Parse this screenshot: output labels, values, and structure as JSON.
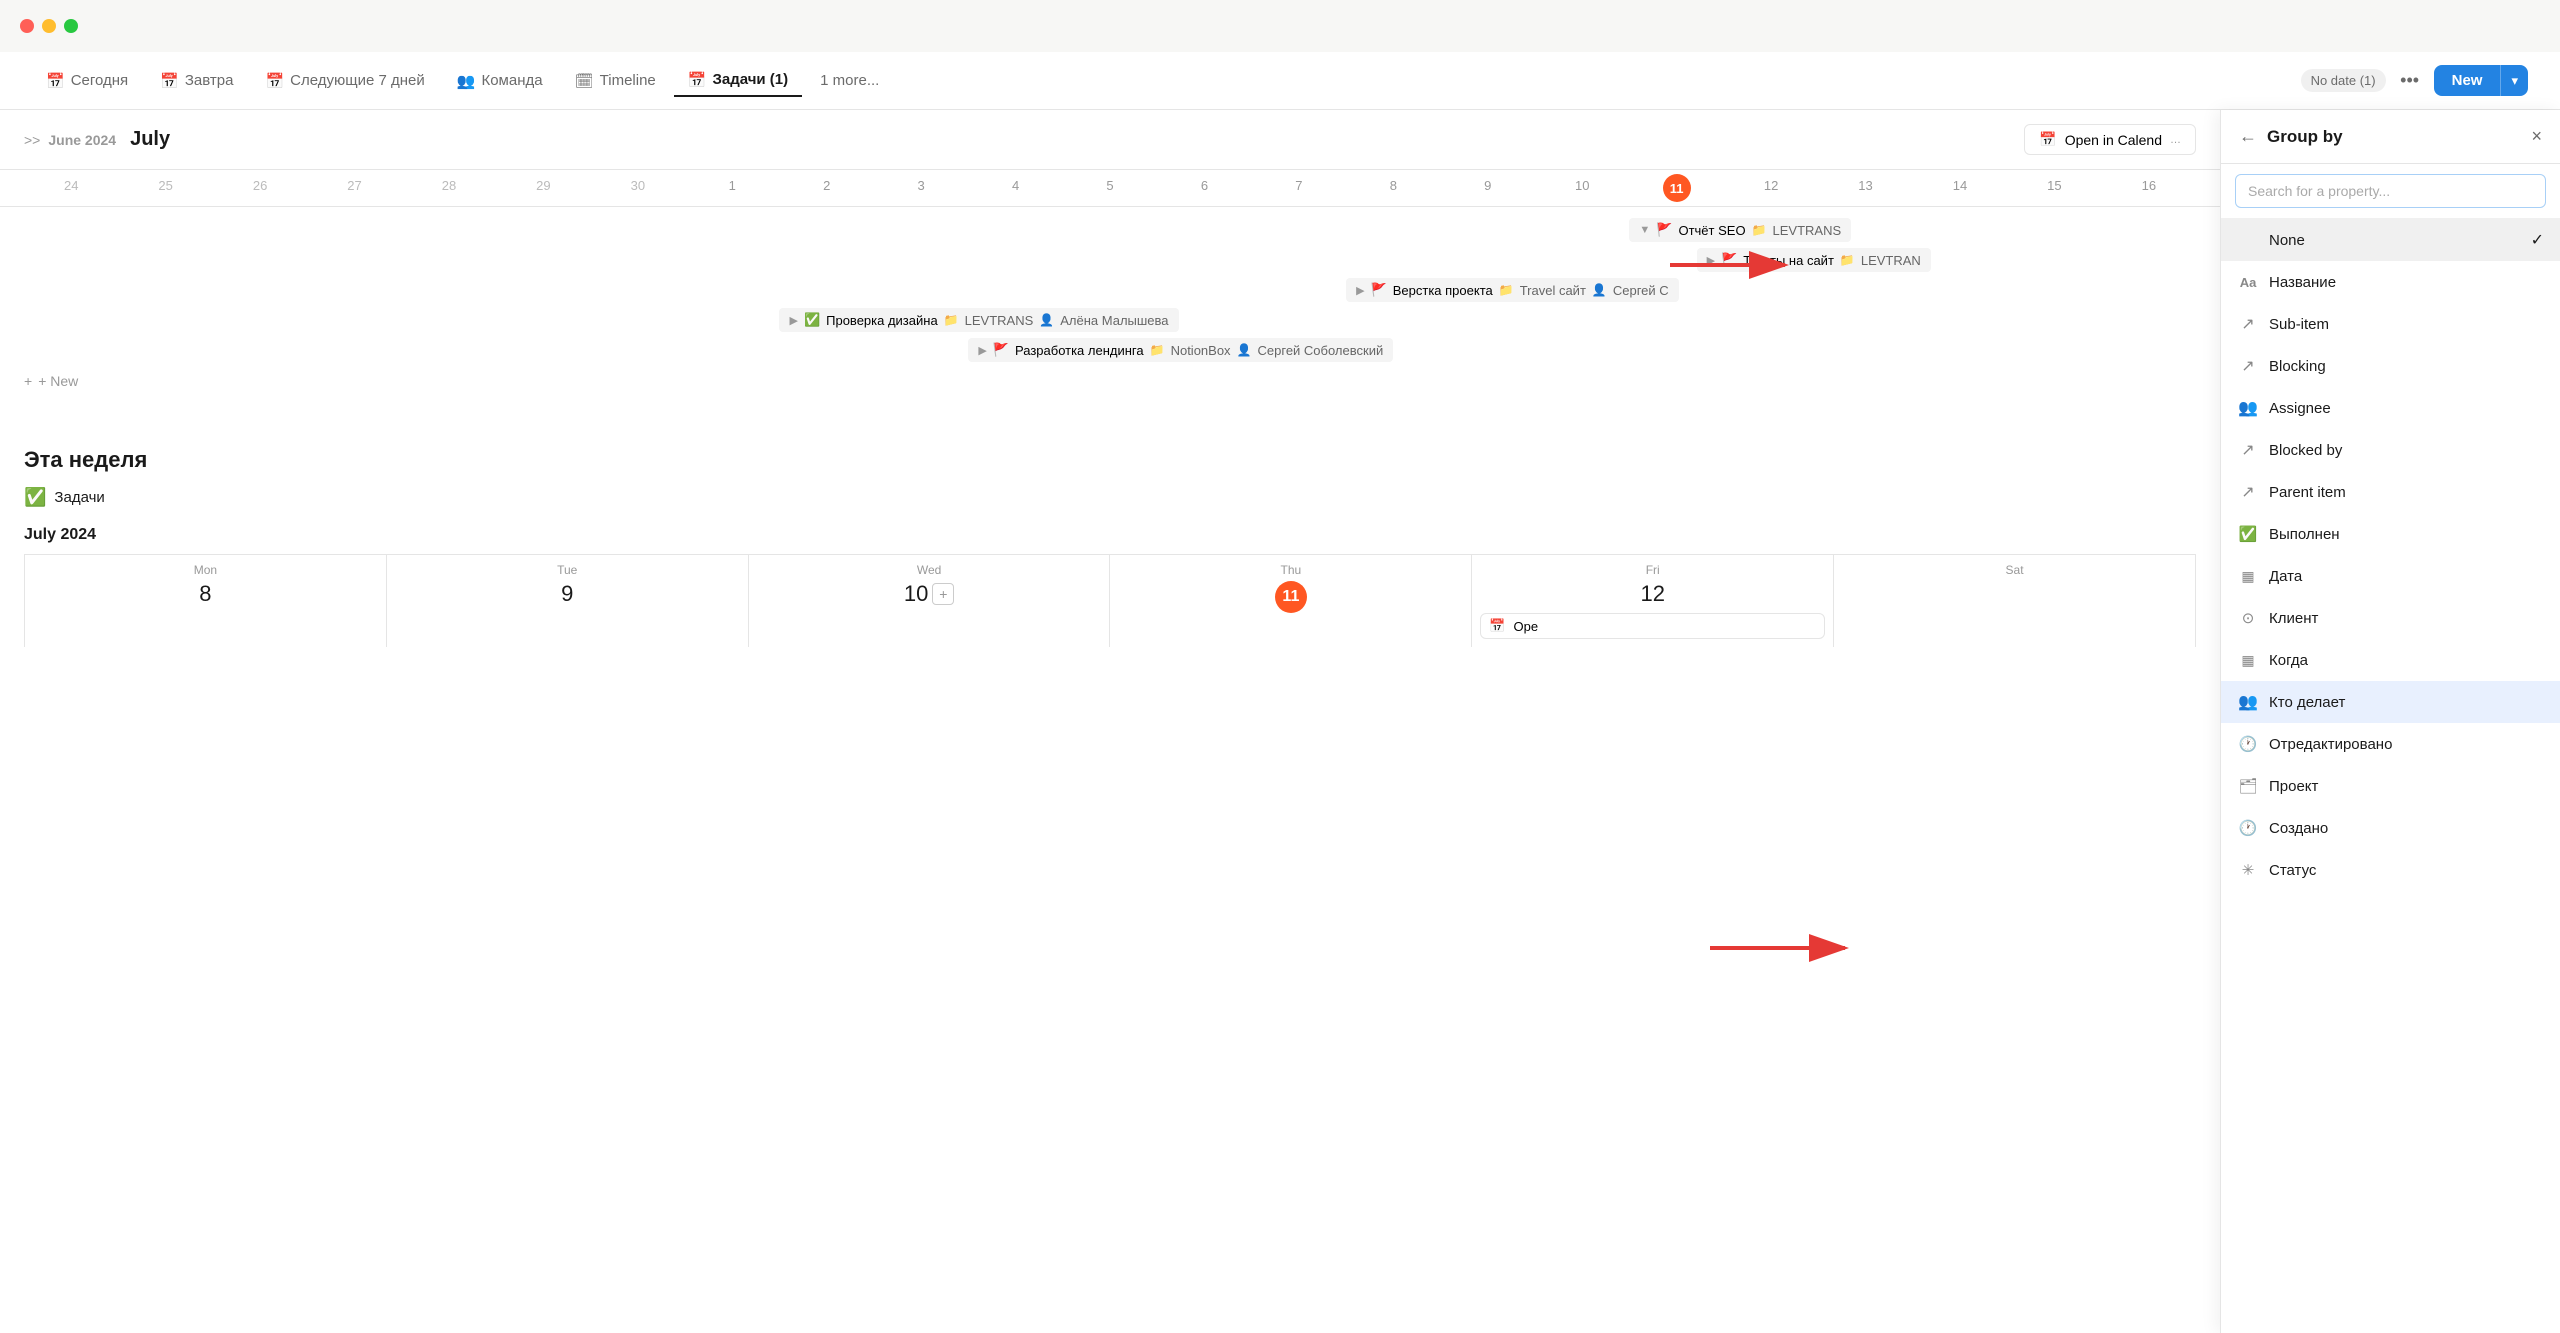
{
  "titlebar": {
    "traffic_lights": [
      "red",
      "yellow",
      "green"
    ]
  },
  "nav": {
    "tabs": [
      {
        "id": "today",
        "label": "Сегодня",
        "icon": "📅"
      },
      {
        "id": "tomorrow",
        "label": "Завтра",
        "icon": "📅"
      },
      {
        "id": "next7",
        "label": "Следующие 7 дней",
        "icon": "📅"
      },
      {
        "id": "team",
        "label": "Команда",
        "icon": "👥"
      },
      {
        "id": "timeline",
        "label": "Timeline",
        "icon": "🗓"
      },
      {
        "id": "zadachi",
        "label": "Задачи (1)",
        "icon": "📅",
        "active": true
      },
      {
        "id": "more",
        "label": "1 more...",
        "icon": ""
      }
    ],
    "no_date": "No date (1)",
    "dots": "•••",
    "new_btn": "New",
    "new_arrow": "▾"
  },
  "calendar": {
    "prev_month": "June 2024",
    "current_month": "July",
    "prev_chevron": ">>",
    "open_in_calendar": "Open in Calend",
    "dates": [
      "24",
      "25",
      "26",
      "27",
      "28",
      "29",
      "30",
      "1",
      "2",
      "3",
      "4",
      "5",
      "6",
      "7",
      "8",
      "9",
      "10",
      "11",
      "12",
      "13",
      "14",
      "15",
      "16"
    ],
    "today_date": "11",
    "tasks": [
      {
        "indent": 0,
        "collapsed": true,
        "flag": true,
        "name": "Отчёт SEO",
        "folder": "LEVTRANS",
        "user": ""
      },
      {
        "indent": 1,
        "collapsed": true,
        "flag": true,
        "name": "Тексты на сайт",
        "folder": "LEVTRAN",
        "user": ""
      },
      {
        "indent": 0,
        "collapsed": true,
        "flag": true,
        "name": "Верстка проекта",
        "folder": "Travel сайт",
        "user": "Сергей С"
      },
      {
        "indent": 0,
        "collapsed": false,
        "flag": false,
        "done": true,
        "name": "Проверка дизайна",
        "folder": "LEVTRANS",
        "user": "Алёна Малышева"
      },
      {
        "indent": 0,
        "collapsed": true,
        "flag": true,
        "name": "Разработка лендинга",
        "folder": "NotionBox",
        "user": "Сергей Соболевский"
      }
    ],
    "add_new": "+ New",
    "this_week_title": "Эта неделя",
    "task_check_label": "Задачи",
    "month_2024_label": "July 2024",
    "week_days": [
      "Mon",
      "Tue",
      "Wed",
      "Thu",
      "Fri",
      "Sat"
    ],
    "week_dates": [
      "8",
      "9",
      "10",
      "11",
      "12",
      ""
    ],
    "today_week_date": "11",
    "open_in_cal_2": "Ope"
  },
  "groupby_panel": {
    "back_icon": "←",
    "title": "Group by",
    "close_icon": "×",
    "search_placeholder": "Search for a property...",
    "items": [
      {
        "id": "none",
        "icon": "",
        "label": "None",
        "check": "✓",
        "type": "none"
      },
      {
        "id": "name",
        "icon": "Aa",
        "label": "Название",
        "check": "",
        "type": "text"
      },
      {
        "id": "subitem",
        "icon": "↗",
        "label": "Sub-item",
        "check": "",
        "type": "link"
      },
      {
        "id": "blocking",
        "icon": "↗",
        "label": "Blocking",
        "check": "",
        "type": "link"
      },
      {
        "id": "assignee",
        "icon": "👥",
        "label": "Assignee",
        "check": "",
        "type": "people"
      },
      {
        "id": "blocked",
        "icon": "↗",
        "label": "Blocked by",
        "check": "",
        "type": "link"
      },
      {
        "id": "parent",
        "icon": "↗",
        "label": "Parent item",
        "check": "",
        "type": "link"
      },
      {
        "id": "vypolnen",
        "icon": "✅",
        "label": "Выполнен",
        "check": "",
        "type": "check"
      },
      {
        "id": "data",
        "icon": "▦",
        "label": "Дата",
        "check": "",
        "type": "calendar"
      },
      {
        "id": "klient",
        "icon": "🔘",
        "label": "Клиент",
        "check": "",
        "type": "option"
      },
      {
        "id": "kogda",
        "icon": "▦",
        "label": "Когда",
        "check": "",
        "type": "calendar"
      },
      {
        "id": "kto",
        "icon": "👥",
        "label": "Кто делает",
        "check": "",
        "type": "people",
        "highlighted": true
      },
      {
        "id": "otred",
        "icon": "🕐",
        "label": "Отредактировано",
        "check": "",
        "type": "time"
      },
      {
        "id": "proekt",
        "icon": "🗂",
        "label": "Проект",
        "check": "",
        "type": "folder"
      },
      {
        "id": "sozdano",
        "icon": "🕐",
        "label": "Создано",
        "check": "",
        "type": "time"
      },
      {
        "id": "status",
        "icon": "✳",
        "label": "Статус",
        "check": "",
        "type": "status"
      }
    ]
  },
  "arrows": {
    "arrow1": "→",
    "arrow2": "→"
  }
}
